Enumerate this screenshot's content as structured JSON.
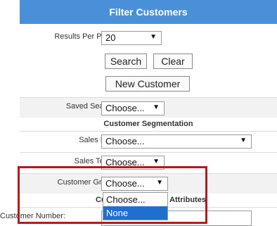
{
  "panel": {
    "title": "Filter Customers"
  },
  "results_per_page": {
    "label": "Results Per Page:",
    "value": "20"
  },
  "buttons": {
    "search": "Search",
    "clear": "Clear",
    "new_customer": "New Customer"
  },
  "saved_search": {
    "label": "Saved Search:",
    "value": "Choose..."
  },
  "customer_segmentation": {
    "title": "Customer Segmentation",
    "sales_rep": {
      "label": "Sales Rep:",
      "value": "Choose..."
    },
    "sales_team": {
      "label": "Sales Team:",
      "value": "Choose..."
    },
    "customer_group": {
      "label": "Customer Group:",
      "value": "Choose...",
      "options": [
        "Choose...",
        "None"
      ],
      "highlighted_option": "None"
    }
  },
  "customer_attributes": {
    "title_left": "Cus",
    "title_right": "Attributes",
    "customer_number": {
      "label": "Customer Number:"
    }
  },
  "icons": {
    "dropdown_arrow": "▼"
  },
  "colors": {
    "header_bg": "#4a90d9",
    "highlight_border": "#b31b1b",
    "selected_option": "#1f6fd1"
  }
}
